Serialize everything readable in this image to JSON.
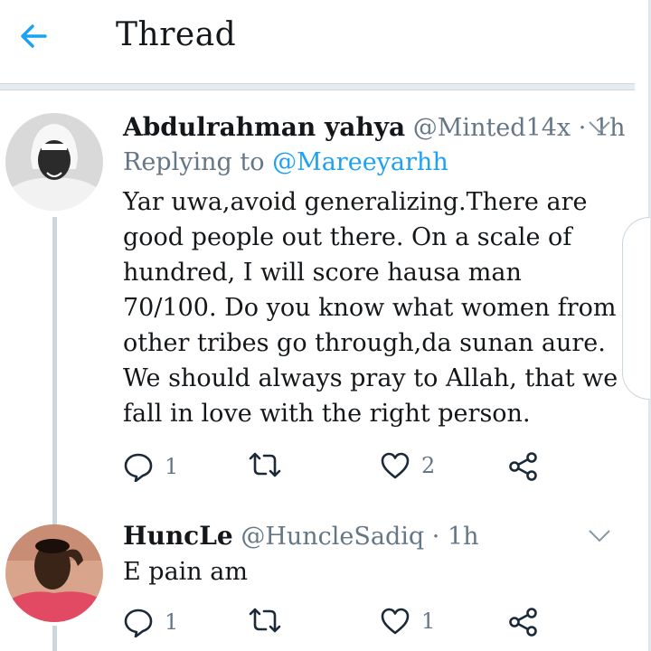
{
  "header": {
    "title": "Thread"
  },
  "tweets": [
    {
      "name": "Abdulrahman yahya",
      "handle": "@Minted14x",
      "time": "1h",
      "replying_prefix": "Replying to ",
      "replying_to": "@Mareeyarhh",
      "text": "Yar uwa,avoid generalizing.There are good people out there. On a scale of hundred, I will score hausa man 70/100. Do you know what women from other tribes go through,da sunan aure. We should always pray to Allah, that we fall in love with the right person.",
      "reply_count": "1",
      "retweet_count": "",
      "like_count": "2"
    },
    {
      "name": "HuncLe",
      "handle": "@HuncleSadiq",
      "time": "1h",
      "text": "E pain am",
      "reply_count": "1",
      "retweet_count": "",
      "like_count": "1"
    }
  ],
  "icons": {
    "back": "arrow-left-icon",
    "caret": "chevron-down-icon",
    "reply": "reply-icon",
    "retweet": "retweet-icon",
    "like": "heart-icon",
    "share": "share-icon"
  },
  "colors": {
    "accent": "#1da1f2",
    "text": "#14171a",
    "secondary": "#657786",
    "divider": "#e6ecf0"
  }
}
